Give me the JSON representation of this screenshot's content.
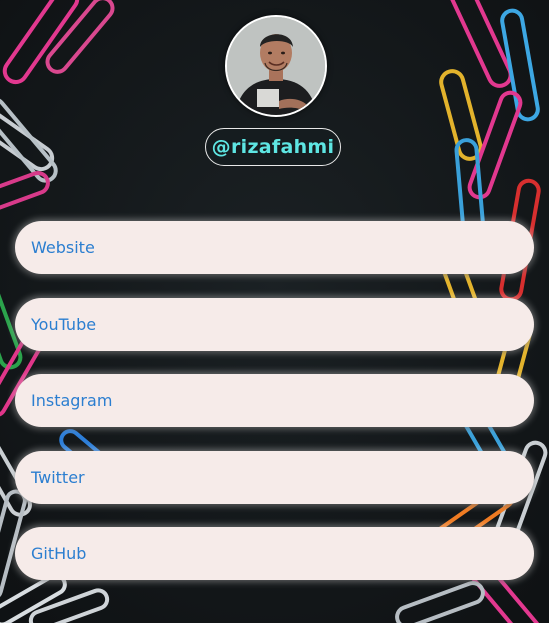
{
  "profile": {
    "handle": "@rizafahmi"
  },
  "links": [
    {
      "label": "Website"
    },
    {
      "label": "YouTube"
    },
    {
      "label": "Instagram"
    },
    {
      "label": "Twitter"
    },
    {
      "label": "GitHub"
    }
  ],
  "colors": {
    "background": "#15191b",
    "handle_text": "#5ee6e3",
    "link_background": "#f6ebe9",
    "link_text": "#2b7ed0"
  },
  "icons": {
    "background": "paperclips-background"
  }
}
